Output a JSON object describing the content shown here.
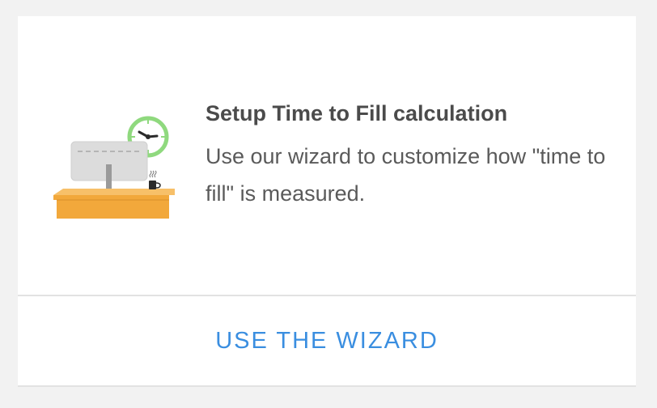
{
  "card": {
    "title": "Setup Time to Fill calculation",
    "description": "Use our wizard to customize how \"time to fill\" is measured.",
    "button_label": "USE THE WIZARD",
    "illustration": {
      "icons": [
        "clock-icon",
        "monitor-icon",
        "coffee-mug-icon",
        "desk-icon"
      ]
    }
  },
  "colors": {
    "accent": "#3a8ee0",
    "title_text": "#4b4b4b",
    "body_text": "#5a5a5a",
    "clock_ring": "#8fd97e",
    "desk": "#f2a83b",
    "monitor": "#d9d9d9"
  }
}
